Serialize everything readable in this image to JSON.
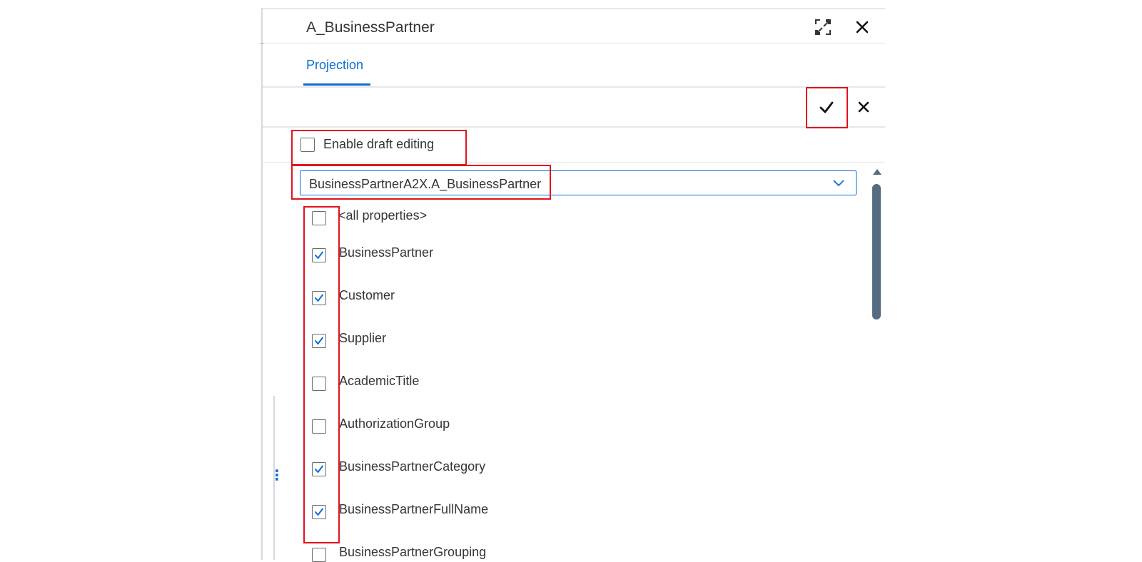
{
  "panel": {
    "title": "A_BusinessPartner",
    "fullscreen_icon": "exit-fullscreen-icon",
    "close_icon": "close-icon"
  },
  "tabs": [
    {
      "label": "Projection",
      "selected": true
    }
  ],
  "toolbar": {
    "confirm_icon": "checkmark-icon",
    "cancel_icon": "close-icon"
  },
  "draft_editing": {
    "label": "Enable draft editing",
    "checked": false
  },
  "entity_select": {
    "value": "BusinessPartnerA2X.A_BusinessPartner"
  },
  "properties": [
    {
      "label": "<all properties>",
      "checked": false
    },
    {
      "label": "BusinessPartner",
      "checked": true
    },
    {
      "label": "Customer",
      "checked": true
    },
    {
      "label": "Supplier",
      "checked": true
    },
    {
      "label": "AcademicTitle",
      "checked": false
    },
    {
      "label": "AuthorizationGroup",
      "checked": false
    },
    {
      "label": "BusinessPartnerCategory",
      "checked": true
    },
    {
      "label": "BusinessPartnerFullName",
      "checked": true
    },
    {
      "label": "BusinessPartnerGrouping",
      "checked": false
    }
  ],
  "colors": {
    "accent": "#0a6ed1",
    "highlight": "#e3121c",
    "text": "#32363a",
    "scrollbar": "#556b82"
  }
}
